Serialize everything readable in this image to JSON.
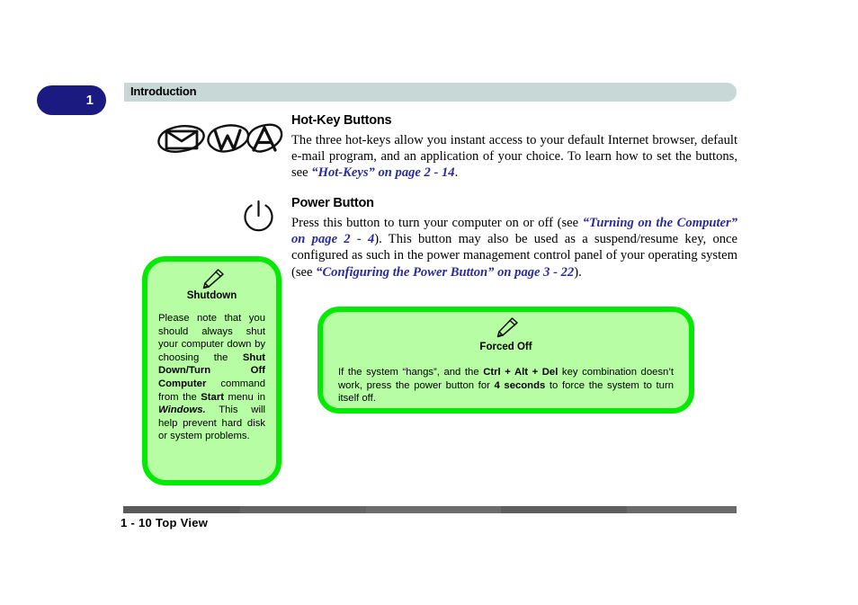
{
  "header": {
    "chapter_number": "1",
    "section_label": "Introduction",
    "bar_color": "#c8d8d6",
    "badge_color": "#1a1a80"
  },
  "icons": {
    "hotkeys_icon": "hotkey-trio-icon",
    "power_icon": "power-symbol-icon",
    "note_pen_icon": "pen-icon"
  },
  "sections": [
    {
      "id": "hotkey",
      "title": "Hot-Key Buttons",
      "paragraph_prefix": "The three hot-keys allow you instant access to your default Internet browser, default e-mail program, and an application of your choice. To learn how to set the buttons, see ",
      "xref": "“Hot-Keys” on page 2 - 14",
      "paragraph_suffix": "."
    },
    {
      "id": "power",
      "title": "Power Button",
      "part1": "Press this button to turn your computer on or off (see ",
      "xref1": "“Turning on the Computer” on page 2 - 4",
      "part2": "). This button may also be used as a suspend/resume key, once configured as such in the power management control panel of your operating system (see ",
      "xref2": "“Configuring the Power Button” on page 3 - 22",
      "part3": ")."
    }
  ],
  "callouts": [
    {
      "id": "shutdown",
      "title": "Shutdown",
      "segments": [
        {
          "text": "Please note that you should always shut your computer down by choosing the ",
          "style": "normal"
        },
        {
          "text": "Shut Down/Turn Off Computer",
          "style": "bold"
        },
        {
          "text": " command from the ",
          "style": "normal"
        },
        {
          "text": "Start",
          "style": "bold"
        },
        {
          "text": " menu in ",
          "style": "normal"
        },
        {
          "text": "Windows.",
          "style": "bolditalic"
        },
        {
          "text": " This will help prevent hard disk or system problems.",
          "style": "normal"
        }
      ]
    },
    {
      "id": "forced-off",
      "title": "Forced Off",
      "segments": [
        {
          "text": "If the system “hangs”, and the ",
          "style": "normal"
        },
        {
          "text": "Ctrl + Alt + Del",
          "style": "bold"
        },
        {
          "text": " key combination doesn’t work, press the power button for ",
          "style": "normal"
        },
        {
          "text": "4 seconds",
          "style": "bold"
        },
        {
          "text": " to force the system to turn itself off.",
          "style": "normal"
        }
      ]
    }
  ],
  "footer": {
    "text": "1 - 10  Top View"
  },
  "colors": {
    "xref_link": "#2b2b9e",
    "callout_fill": "#b6fda4",
    "callout_border": "#04ea04",
    "footer_rule": "#5a5a5a"
  }
}
